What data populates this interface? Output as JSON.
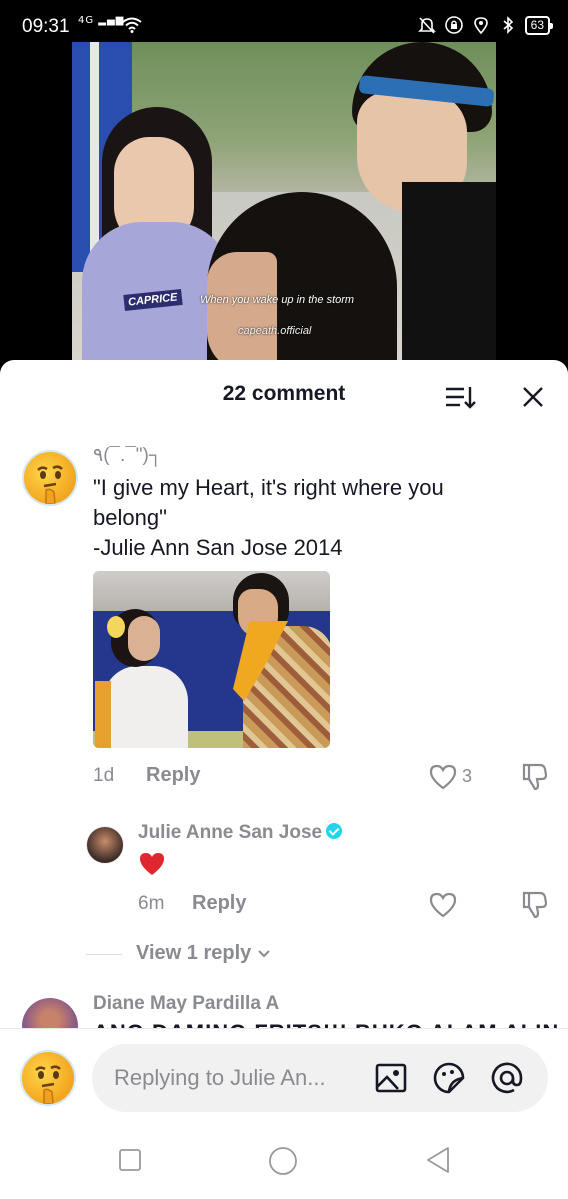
{
  "status_bar": {
    "time": "09:31",
    "network": "4G",
    "battery": "63"
  },
  "video": {
    "tag": "CAPRICE",
    "caption": "When you wake up in the storm",
    "watermark": "capeath.official"
  },
  "comments_sheet": {
    "title": "22 comment"
  },
  "comment1": {
    "username": "٩(¯.¯\")┐",
    "text_lines": [
      "\"I give my Heart, it's right where you",
      "belong\"",
      "-Julie Ann San Jose 2014"
    ],
    "time": "1d",
    "reply_label": "Reply",
    "likes": "3"
  },
  "reply1": {
    "username": "Julie Anne San Jose",
    "emoji": "❤",
    "time": "6m",
    "reply_label": "Reply"
  },
  "view_replies": "View 1 reply",
  "comment2": {
    "username": "Diane May Pardilla A",
    "text": "ANG DAMING FRITS!!! BUKO ALAM ALIN"
  },
  "input": {
    "placeholder": "Replying to Julie An..."
  },
  "colors": {
    "verified": "#20d5ec",
    "heart": "#e0262f",
    "muted": "#8a8b91"
  }
}
